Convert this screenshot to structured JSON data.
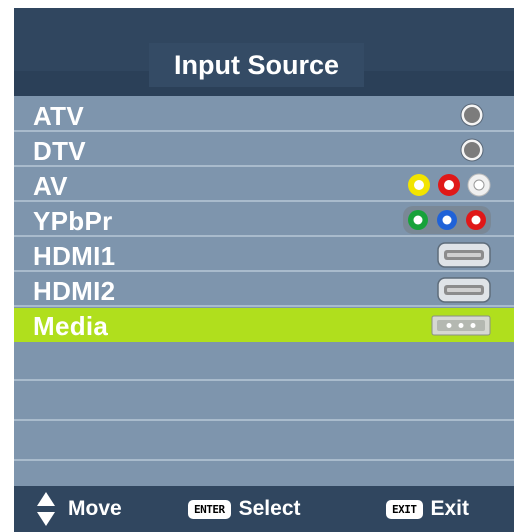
{
  "header": {
    "title": "Input Source"
  },
  "sources": [
    {
      "label": "ATV",
      "icon": "tv-antenna-port-icon",
      "selected": false
    },
    {
      "label": "DTV",
      "icon": "tv-antenna-port-icon",
      "selected": false
    },
    {
      "label": "AV",
      "icon": "composite-av-ports-icon",
      "selected": false
    },
    {
      "label": "YPbPr",
      "icon": "component-ypbpr-ports-icon",
      "selected": false
    },
    {
      "label": "HDMI1",
      "icon": "hdmi-port-icon",
      "selected": false
    },
    {
      "label": "HDMI2",
      "icon": "hdmi-port-icon",
      "selected": false
    },
    {
      "label": "Media",
      "icon": "usb-media-port-icon",
      "selected": true
    }
  ],
  "footer": {
    "move_label": "Move",
    "enter_key": "ENTER",
    "select_label": "Select",
    "exit_key": "EXIT",
    "exit_label": "Exit"
  },
  "colors": {
    "header_bg": "#30465f",
    "list_bg": "#7e95ad",
    "selected_bg": "#b0df1d",
    "divider": "#a9bbcc",
    "av_yellow": "#f2e400",
    "av_red": "#e01818",
    "ypbpr_green": "#17a23a",
    "ypbpr_blue": "#1f62d8"
  }
}
